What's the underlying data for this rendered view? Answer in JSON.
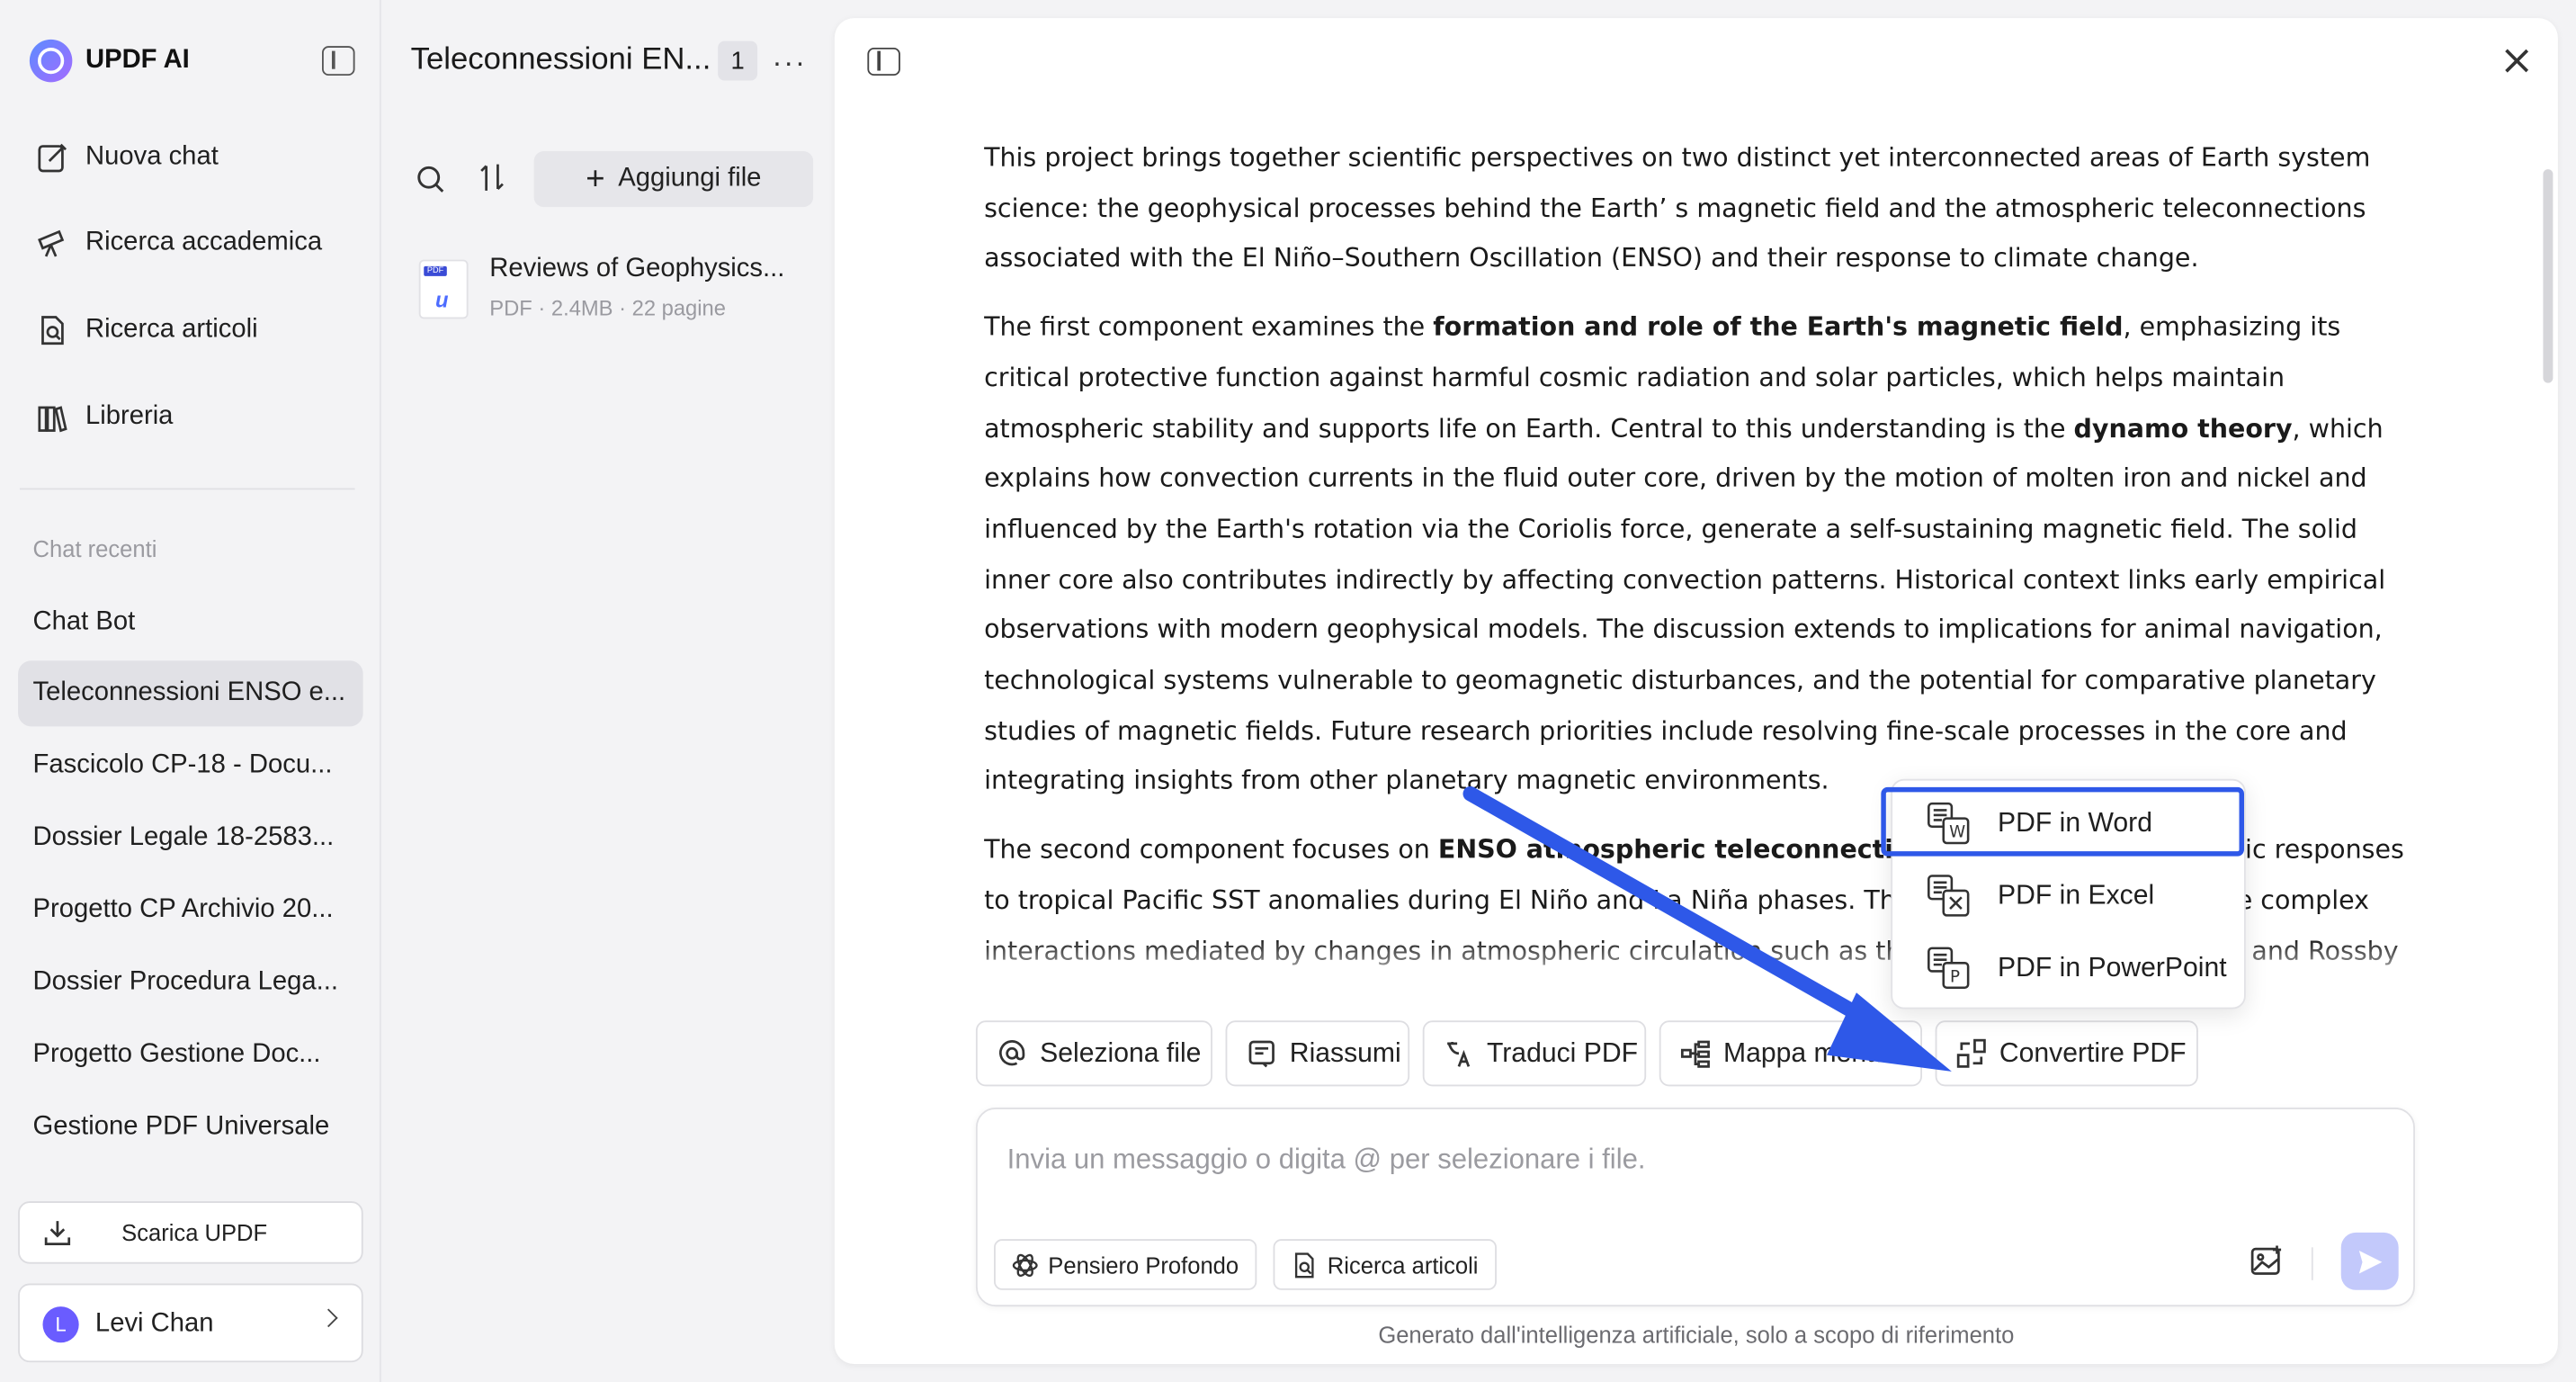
{
  "brand": {
    "name": "UPDF AI"
  },
  "nav": [
    {
      "label": "Nuova chat",
      "icon": "edit-icon"
    },
    {
      "label": "Ricerca accademica",
      "icon": "telescope-icon"
    },
    {
      "label": "Ricerca articoli",
      "icon": "doc-search-icon"
    },
    {
      "label": "Libreria",
      "icon": "library-icon"
    }
  ],
  "recent": {
    "label": "Chat recenti",
    "items": [
      "Chat Bot",
      "Teleconnessioni ENSO e...",
      "Fascicolo CP-18 - Docu...",
      "Dossier Legale 18-2583...",
      "Progetto CP Archivio 20...",
      "Dossier Procedura Lega...",
      "Progetto Gestione Doc...",
      "Gestione PDF Universale"
    ]
  },
  "download": {
    "label": "Scarica UPDF"
  },
  "user": {
    "initial": "L",
    "name": "Levi Chan"
  },
  "filepanel": {
    "title": "Teleconnessioni EN...",
    "count": "1",
    "more": "···",
    "add_label": "Aggiungi file",
    "file": {
      "name": "Reviews of Geophysics...",
      "meta": "PDF · 2.4MB · 22 pagine",
      "tag": "PDF"
    }
  },
  "content": {
    "p1": "This project brings together scientific perspectives on two distinct yet interconnected areas of Earth system science: the geophysical processes behind the Earth’ s magnetic field and the atmospheric teleconnections associated with the El Niño–Southern Oscillation (ENSO) and their response to climate change.",
    "p2_a": "The first component examines the ",
    "p2_b": "formation and role of the Earth's magnetic field",
    "p2_c": ", emphasizing its critical protective function against harmful cosmic radiation and solar particles, which helps maintain atmospheric stability and supports life on Earth. Central to this understanding is the ",
    "p2_d": "dynamo theory",
    "p2_e": ", which explains how convection currents in the fluid outer core, driven by the motion of molten iron and nickel and influenced by the Earth's rotation via the Coriolis force, generate a self-sustaining magnetic field. The solid inner core also contributes indirectly by affecting convection patterns. Historical context links early empirical observations with modern geophysical models. The discussion extends to implications for animal navigation, technological systems vulnerable to geomagnetic disturbances, and the potential for comparative planetary studies of magnetic fields. Future research priorities include resolving fine-scale processes in the core and integrating insights from other planetary magnetic environments.",
    "p3_a": "The second component focuses on ",
    "p3_b": "ENSO atmospheric teleconnections",
    "p3_c": "—the global atmospheric responses to tropical Pacific SST anomalies during El Niño and La Niña phases. These teleconnections involve complex interactions mediated by changes in atmospheric circulation such as the Pacific Walker circulation and Rossby wave patterns, influencing precipitation, temperature, and extreme events across the globe. It highlights how ENSO"
  },
  "chips": [
    {
      "label": "Seleziona file",
      "icon": "at-icon"
    },
    {
      "label": "Riassumi",
      "icon": "summary-icon"
    },
    {
      "label": "Traduci PDF",
      "icon": "translate-icon"
    },
    {
      "label": "Mappa mentale",
      "icon": "mindmap-icon"
    },
    {
      "label": "Convertire PDF",
      "icon": "convert-icon"
    }
  ],
  "menu": [
    {
      "label": "PDF in Word",
      "icon": "word-convert-icon",
      "letter": "W"
    },
    {
      "label": "PDF in Excel",
      "icon": "excel-convert-icon",
      "letter": "X"
    },
    {
      "label": "PDF in PowerPoint",
      "icon": "powerpoint-convert-icon",
      "letter": "P"
    }
  ],
  "input": {
    "placeholder": "Invia un messaggio o digita @ per selezionare i file.",
    "deep_think": "Pensiero Profondo",
    "article_search": "Ricerca articoli"
  },
  "footer": "Generato dall'intelligenza artificiale, solo a scopo di riferimento",
  "colors": {
    "accent": "#2e58e8",
    "send": "#c3c9fb",
    "active_item": "#e1e1e6"
  }
}
